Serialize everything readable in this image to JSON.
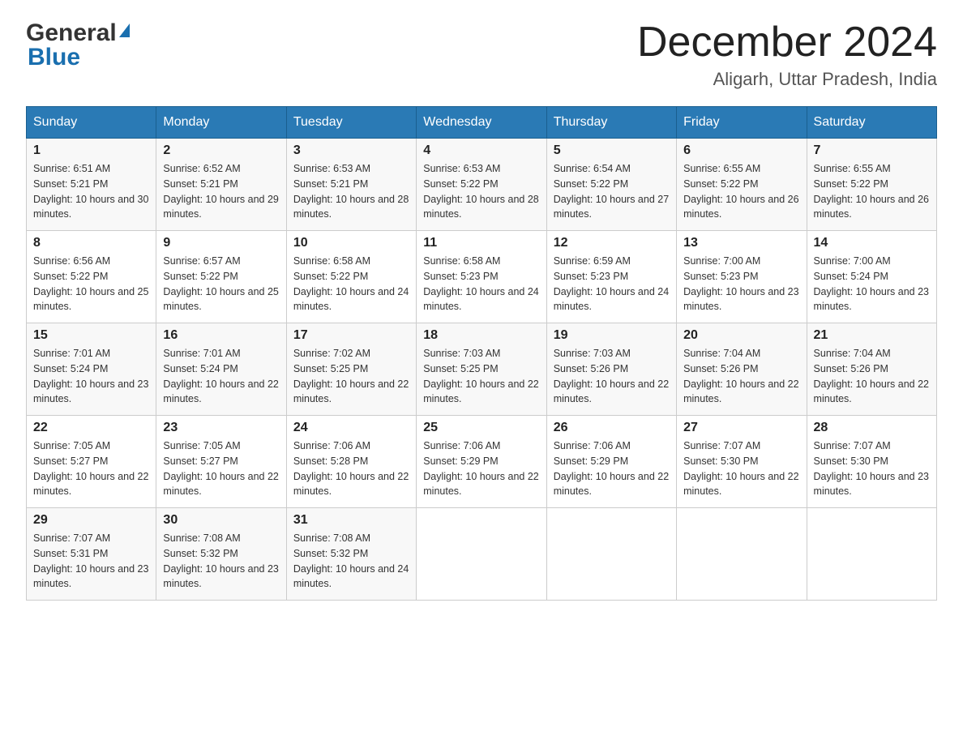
{
  "logo": {
    "text_general": "General",
    "text_blue": "Blue",
    "triangle_char": "▶"
  },
  "header": {
    "title": "December 2024",
    "subtitle": "Aligarh, Uttar Pradesh, India"
  },
  "weekdays": [
    "Sunday",
    "Monday",
    "Tuesday",
    "Wednesday",
    "Thursday",
    "Friday",
    "Saturday"
  ],
  "weeks": [
    [
      {
        "day": "1",
        "sunrise": "6:51 AM",
        "sunset": "5:21 PM",
        "daylight": "10 hours and 30 minutes."
      },
      {
        "day": "2",
        "sunrise": "6:52 AM",
        "sunset": "5:21 PM",
        "daylight": "10 hours and 29 minutes."
      },
      {
        "day": "3",
        "sunrise": "6:53 AM",
        "sunset": "5:21 PM",
        "daylight": "10 hours and 28 minutes."
      },
      {
        "day": "4",
        "sunrise": "6:53 AM",
        "sunset": "5:22 PM",
        "daylight": "10 hours and 28 minutes."
      },
      {
        "day": "5",
        "sunrise": "6:54 AM",
        "sunset": "5:22 PM",
        "daylight": "10 hours and 27 minutes."
      },
      {
        "day": "6",
        "sunrise": "6:55 AM",
        "sunset": "5:22 PM",
        "daylight": "10 hours and 26 minutes."
      },
      {
        "day": "7",
        "sunrise": "6:55 AM",
        "sunset": "5:22 PM",
        "daylight": "10 hours and 26 minutes."
      }
    ],
    [
      {
        "day": "8",
        "sunrise": "6:56 AM",
        "sunset": "5:22 PM",
        "daylight": "10 hours and 25 minutes."
      },
      {
        "day": "9",
        "sunrise": "6:57 AM",
        "sunset": "5:22 PM",
        "daylight": "10 hours and 25 minutes."
      },
      {
        "day": "10",
        "sunrise": "6:58 AM",
        "sunset": "5:22 PM",
        "daylight": "10 hours and 24 minutes."
      },
      {
        "day": "11",
        "sunrise": "6:58 AM",
        "sunset": "5:23 PM",
        "daylight": "10 hours and 24 minutes."
      },
      {
        "day": "12",
        "sunrise": "6:59 AM",
        "sunset": "5:23 PM",
        "daylight": "10 hours and 24 minutes."
      },
      {
        "day": "13",
        "sunrise": "7:00 AM",
        "sunset": "5:23 PM",
        "daylight": "10 hours and 23 minutes."
      },
      {
        "day": "14",
        "sunrise": "7:00 AM",
        "sunset": "5:24 PM",
        "daylight": "10 hours and 23 minutes."
      }
    ],
    [
      {
        "day": "15",
        "sunrise": "7:01 AM",
        "sunset": "5:24 PM",
        "daylight": "10 hours and 23 minutes."
      },
      {
        "day": "16",
        "sunrise": "7:01 AM",
        "sunset": "5:24 PM",
        "daylight": "10 hours and 22 minutes."
      },
      {
        "day": "17",
        "sunrise": "7:02 AM",
        "sunset": "5:25 PM",
        "daylight": "10 hours and 22 minutes."
      },
      {
        "day": "18",
        "sunrise": "7:03 AM",
        "sunset": "5:25 PM",
        "daylight": "10 hours and 22 minutes."
      },
      {
        "day": "19",
        "sunrise": "7:03 AM",
        "sunset": "5:26 PM",
        "daylight": "10 hours and 22 minutes."
      },
      {
        "day": "20",
        "sunrise": "7:04 AM",
        "sunset": "5:26 PM",
        "daylight": "10 hours and 22 minutes."
      },
      {
        "day": "21",
        "sunrise": "7:04 AM",
        "sunset": "5:26 PM",
        "daylight": "10 hours and 22 minutes."
      }
    ],
    [
      {
        "day": "22",
        "sunrise": "7:05 AM",
        "sunset": "5:27 PM",
        "daylight": "10 hours and 22 minutes."
      },
      {
        "day": "23",
        "sunrise": "7:05 AM",
        "sunset": "5:27 PM",
        "daylight": "10 hours and 22 minutes."
      },
      {
        "day": "24",
        "sunrise": "7:06 AM",
        "sunset": "5:28 PM",
        "daylight": "10 hours and 22 minutes."
      },
      {
        "day": "25",
        "sunrise": "7:06 AM",
        "sunset": "5:29 PM",
        "daylight": "10 hours and 22 minutes."
      },
      {
        "day": "26",
        "sunrise": "7:06 AM",
        "sunset": "5:29 PM",
        "daylight": "10 hours and 22 minutes."
      },
      {
        "day": "27",
        "sunrise": "7:07 AM",
        "sunset": "5:30 PM",
        "daylight": "10 hours and 22 minutes."
      },
      {
        "day": "28",
        "sunrise": "7:07 AM",
        "sunset": "5:30 PM",
        "daylight": "10 hours and 23 minutes."
      }
    ],
    [
      {
        "day": "29",
        "sunrise": "7:07 AM",
        "sunset": "5:31 PM",
        "daylight": "10 hours and 23 minutes."
      },
      {
        "day": "30",
        "sunrise": "7:08 AM",
        "sunset": "5:32 PM",
        "daylight": "10 hours and 23 minutes."
      },
      {
        "day": "31",
        "sunrise": "7:08 AM",
        "sunset": "5:32 PM",
        "daylight": "10 hours and 24 minutes."
      },
      null,
      null,
      null,
      null
    ]
  ],
  "labels": {
    "sunrise": "Sunrise: ",
    "sunset": "Sunset: ",
    "daylight": "Daylight: "
  }
}
